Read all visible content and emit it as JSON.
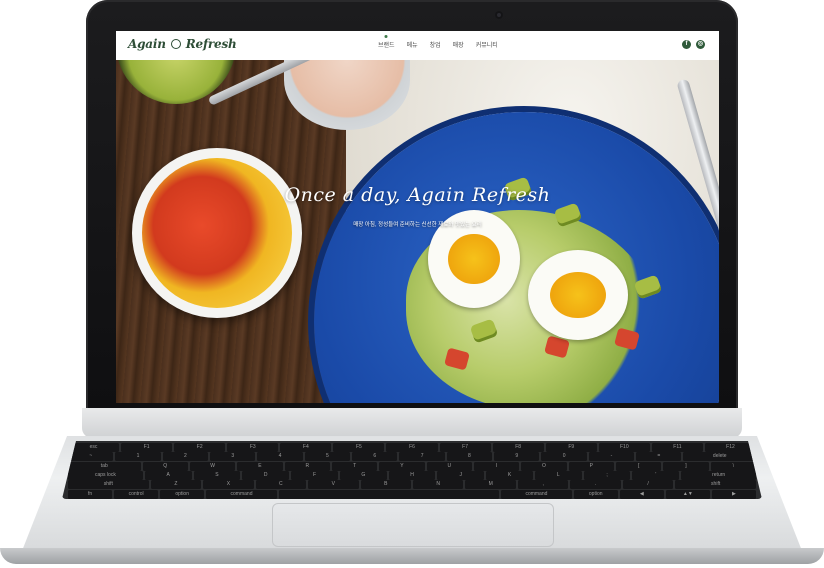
{
  "site": {
    "logo_left": "Again",
    "logo_right": "Refresh",
    "nav_items": [
      {
        "label": "브랜드",
        "active": true
      },
      {
        "label": "메뉴",
        "active": false
      },
      {
        "label": "창업",
        "active": false
      },
      {
        "label": "매장",
        "active": false
      },
      {
        "label": "커뮤니티",
        "active": false
      }
    ],
    "social": [
      {
        "icon": "facebook-icon",
        "glyph": "f"
      },
      {
        "icon": "instagram-icon",
        "glyph": "◎"
      }
    ],
    "hero": {
      "title": "Once a day, Again Refresh",
      "subtitle": "매장 아침, 정성들여 준비하는 신선한 재료와 맛있는 요리"
    }
  },
  "keyboard": {
    "rows": [
      [
        "esc",
        "F1",
        "F2",
        "F3",
        "F4",
        "F5",
        "F6",
        "F7",
        "F8",
        "F9",
        "F10",
        "F11",
        "F12"
      ],
      [
        "~",
        "1",
        "2",
        "3",
        "4",
        "5",
        "6",
        "7",
        "8",
        "9",
        "0",
        "-",
        "=",
        "delete"
      ],
      [
        "tab",
        "Q",
        "W",
        "E",
        "R",
        "T",
        "Y",
        "U",
        "I",
        "O",
        "P",
        "[",
        "]",
        "\\"
      ],
      [
        "caps lock",
        "A",
        "S",
        "D",
        "F",
        "G",
        "H",
        "J",
        "K",
        "L",
        ";",
        "'",
        "return"
      ],
      [
        "shift",
        "Z",
        "X",
        "C",
        "V",
        "B",
        "N",
        "M",
        ",",
        ".",
        "/",
        "shift"
      ],
      [
        "fn",
        "control",
        "option",
        "command",
        "",
        "command",
        "option",
        "◀",
        "▲▼",
        "▶"
      ]
    ]
  },
  "colors": {
    "brand_green": "#2d4d36",
    "plate_blue": "#1a4aa8"
  }
}
